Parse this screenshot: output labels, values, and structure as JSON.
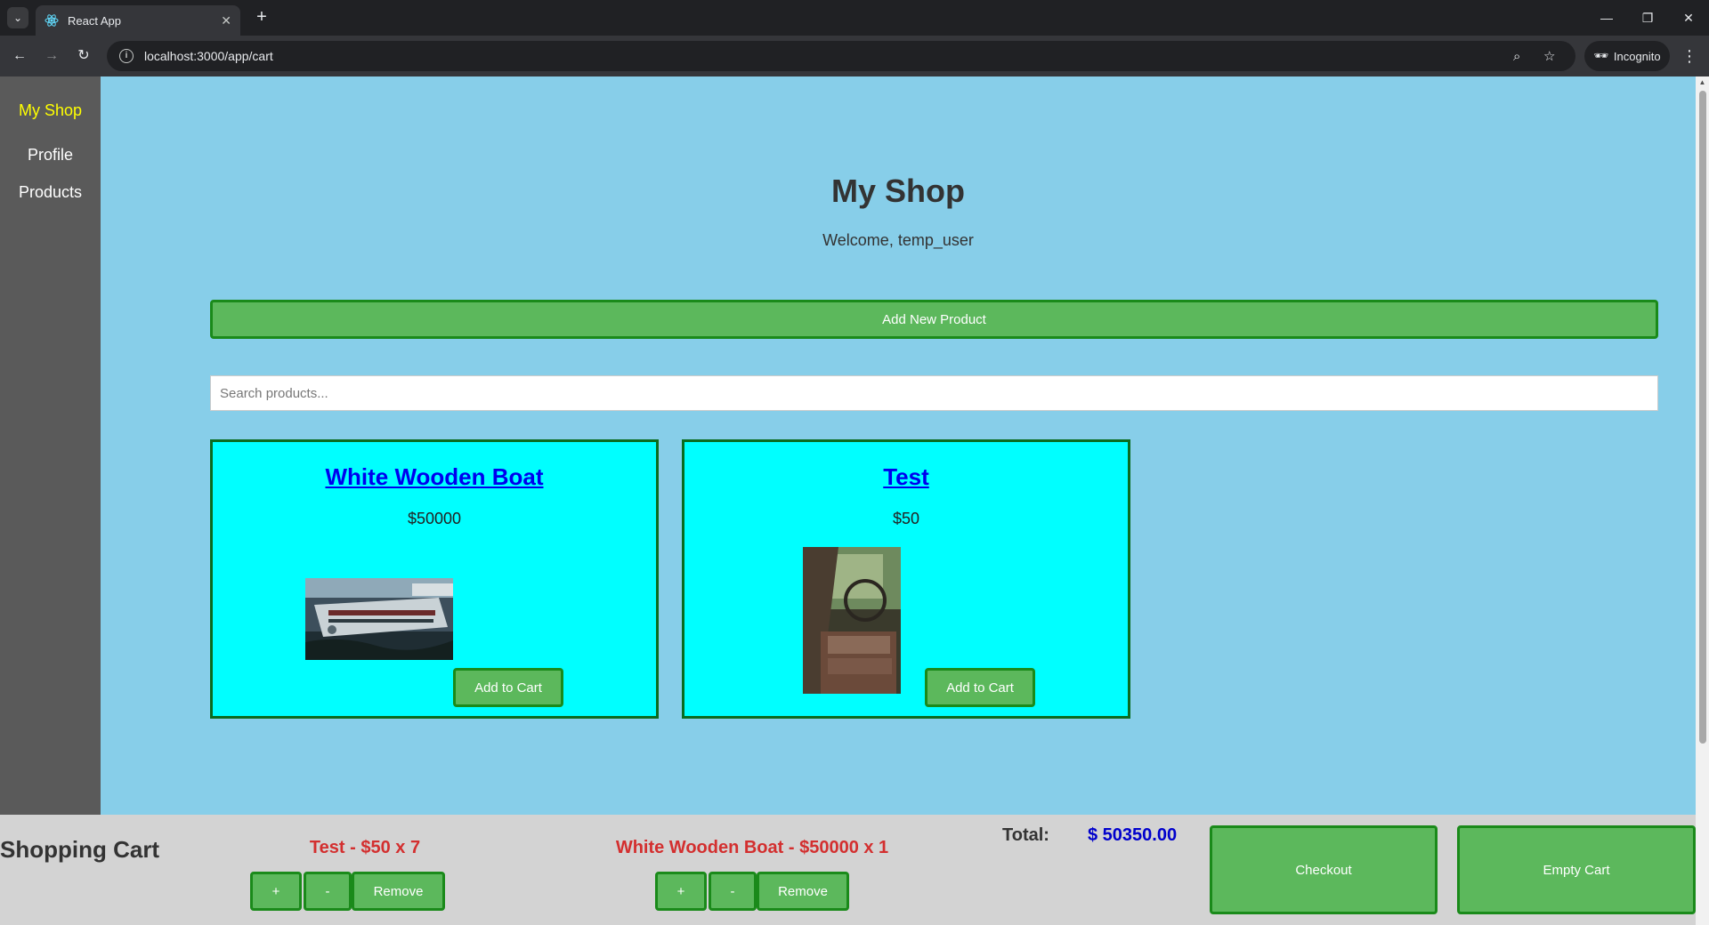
{
  "browser": {
    "tab_title": "React App",
    "url": "localhost:3000/app/cart",
    "incognito_label": "Incognito",
    "icons": [
      "tab-list-icon",
      "react-favicon-icon",
      "close-tab-icon",
      "new-tab-icon",
      "minimize-icon",
      "restore-icon",
      "close-window-icon",
      "back-icon",
      "forward-icon",
      "reload-icon",
      "site-info-icon",
      "zoom-icon",
      "bookmark-star-icon",
      "incognito-icon",
      "menu-kebab-icon"
    ]
  },
  "sidebar": {
    "items": [
      {
        "label": "My Shop",
        "active": true
      },
      {
        "label": "Profile",
        "active": false
      },
      {
        "label": "Products",
        "active": false
      }
    ]
  },
  "header": {
    "title": "My Shop",
    "welcome": "Welcome, temp_user"
  },
  "actions": {
    "add_product_label": "Add New Product"
  },
  "search": {
    "placeholder": "Search products...",
    "value": ""
  },
  "products": [
    {
      "name": "White Wooden Boat",
      "price": "$50000",
      "button": "Add to Cart",
      "image": "boat-photo"
    },
    {
      "name": "Test",
      "price": "$50",
      "button": "Add to Cart",
      "image": "truck-interior-photo"
    }
  ],
  "cart": {
    "heading": "Shopping Cart",
    "items": [
      {
        "label": "Test - $50 x 7",
        "plus": "+",
        "minus": "-",
        "remove": "Remove"
      },
      {
        "label": "White Wooden Boat - $50000 x 1",
        "plus": "+",
        "minus": "-",
        "remove": "Remove"
      }
    ],
    "total_label": "Total:",
    "total_value": "$ 50350.00",
    "checkout_label": "Checkout",
    "empty_label": "Empty Cart"
  },
  "colors": {
    "page_bg": "#87cee9",
    "sidebar_bg": "#5a5a5a",
    "active_nav": "#ffff00",
    "card_bg": "#00ffff",
    "button_green": "#5cb85c",
    "button_border": "#1a8a1a",
    "cart_item_red": "#d32f2f",
    "total_blue": "#0000cc"
  }
}
